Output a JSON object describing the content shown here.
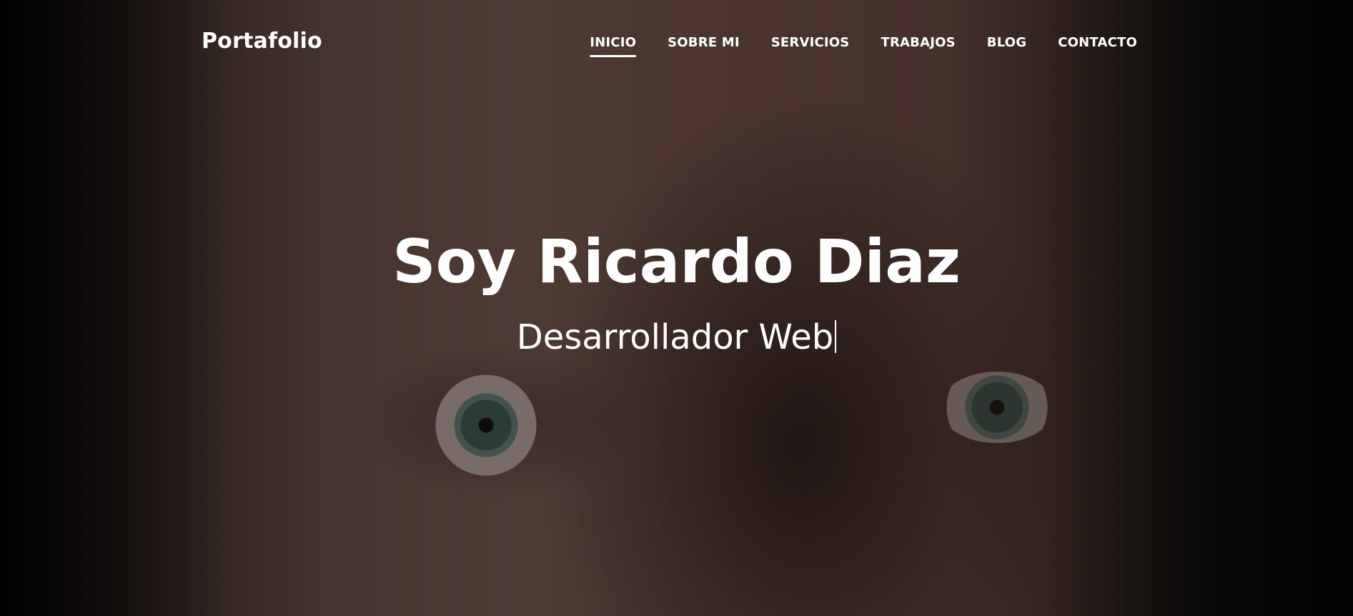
{
  "nav": {
    "brand": "Portafolio",
    "items": [
      {
        "label": "INICIO",
        "active": true
      },
      {
        "label": "SOBRE MI",
        "active": false
      },
      {
        "label": "SERVICIOS",
        "active": false
      },
      {
        "label": "TRABAJOS",
        "active": false
      },
      {
        "label": "BLOG",
        "active": false
      },
      {
        "label": "CONTACTO",
        "active": false
      }
    ]
  },
  "hero": {
    "title": "Soy Ricardo Diaz",
    "subtitle": "Desarrollador Web",
    "background": "portrait-photo"
  },
  "colors": {
    "text": "#ffffff",
    "overlay": "#000000"
  }
}
